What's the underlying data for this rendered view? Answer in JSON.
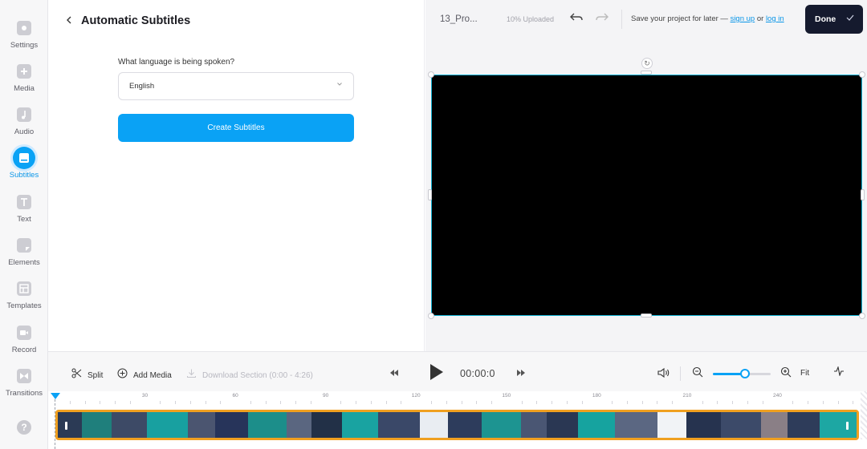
{
  "sidebar": {
    "items": [
      {
        "label": "Settings",
        "icon": "gear-icon"
      },
      {
        "label": "Media",
        "icon": "plus-icon"
      },
      {
        "label": "Audio",
        "icon": "music-note-icon"
      },
      {
        "label": "Subtitles",
        "icon": "subtitles-icon",
        "active": true
      },
      {
        "label": "Text",
        "icon": "text-icon"
      },
      {
        "label": "Elements",
        "icon": "sticker-icon"
      },
      {
        "label": "Templates",
        "icon": "layout-icon"
      },
      {
        "label": "Record",
        "icon": "camera-icon"
      },
      {
        "label": "Transitions",
        "icon": "bowtie-icon"
      }
    ],
    "help_label": "?"
  },
  "panel": {
    "title": "Automatic Subtitles",
    "language_question": "What language is being spoken?",
    "language_value": "English",
    "create_button": "Create Subtitles"
  },
  "topbar": {
    "project_name": "13_Pro...",
    "upload_status": "10% Uploaded",
    "save_prefix": "Save your project for later — ",
    "sign_up": "sign up",
    "save_or": " or ",
    "log_in": "log in",
    "done_label": "Done"
  },
  "transport": {
    "split_label": "Split",
    "add_media_label": "Add Media",
    "download_label": "Download Section (0:00 - 4:26)",
    "timecode": "00:00:0",
    "fit_label": "Fit",
    "zoom_level": 0.55
  },
  "timeline": {
    "ticks": [
      "30",
      "60",
      "90",
      "120",
      "150",
      "180",
      "210",
      "240"
    ]
  },
  "colors": {
    "accent": "#0aa2f5",
    "done_bg": "#151a2e",
    "track_border": "#f0a020",
    "frame_border": "#11b2d4"
  }
}
